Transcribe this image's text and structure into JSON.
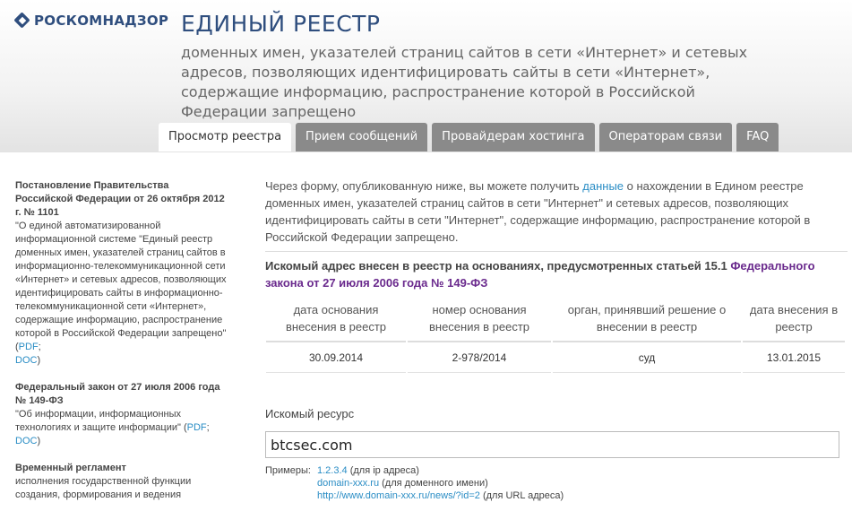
{
  "header": {
    "logo_text": "РОСКОМНАДЗОР",
    "title": "ЕДИНЫЙ РЕЕСТР",
    "subtitle": "доменных имен, указателей страниц сайтов в сети «Интернет» и сетевых адресов, позволяющих идентифицировать сайты в сети «Интернет», содержащие информацию, распространение которой в Российской Федерации запрещено"
  },
  "tabs": [
    {
      "label": "Просмотр реестра",
      "active": true
    },
    {
      "label": "Прием сообщений"
    },
    {
      "label": "Провайдерам хостинга"
    },
    {
      "label": "Операторам связи"
    },
    {
      "label": "FAQ"
    }
  ],
  "sidebar": {
    "docs": [
      {
        "title": "Постановление Правительства Российской Федерации от 26 октября 2012 г. № 1101",
        "desc": "\"О единой автоматизированной информационной системе \"Единый реестр доменных имен, указателей страниц сайтов в информационно-телекоммуникационной сети «Интернет» и сетевых адресов, позволяющих идентифицировать сайты в информационно-телекоммуникационной сети «Интернет», содержащие информацию, распространение которой в Российской Федерации запрещено\" (",
        "pdf": "PDF",
        "sep": ";",
        "doc": "DOC",
        "end": ")"
      },
      {
        "title": "Федеральный закон от 27 июля 2006 года № 149-ФЗ",
        "desc": "\"Об информации, информационных технологиях и защите информации\" (",
        "pdf": "PDF",
        "sep": ";",
        "doc": "DOC",
        "end": ")"
      },
      {
        "title": "Временный регламент",
        "desc": "исполнения государственной функции создания, формирования и ведения"
      }
    ]
  },
  "main": {
    "intro_before": "Через форму, опубликованную ниже, вы можете получить ",
    "intro_link": "данные",
    "intro_after": " о нахождении в Едином реестре доменных имен, указателей страниц сайтов в сети \"Интернет\" и сетевых адресов, позволяющих идентифицировать сайты в сети \"Интернет\", содержащие информацию, распространение которой в Российской Федерации запрещено.",
    "basis_before": "Искомый адрес внесен в реестр на основаниях, предусмотренных статьей 15.1 ",
    "basis_link": "Федерального закона от 27 июля 2006 года № 149-ФЗ",
    "table": {
      "headers": [
        "дата основания внесения в реестр",
        "номер основания внесения в реестр",
        "орган, принявший решение о внесении в реестр",
        "дата внесения в реестр"
      ],
      "rows": [
        [
          "30.09.2014",
          "2-978/2014",
          "суд",
          "13.01.2015"
        ]
      ]
    },
    "resource_label": "Искомый ресурс",
    "resource_value": "btcsec.com",
    "examples": {
      "label": "Примеры:",
      "ip": "1.2.3.4",
      "ip_note": " (для ip адреса)",
      "domain": "domain-xxx.ru",
      "domain_note": " (для доменного имени)",
      "url": "http://www.domain-xxx.ru/news/?id=2",
      "url_note": " (для URL адреса)"
    }
  }
}
